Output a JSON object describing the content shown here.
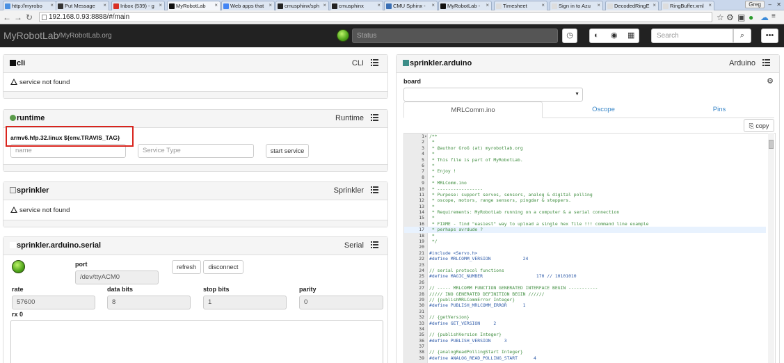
{
  "browser": {
    "tabs": [
      {
        "label": "http://myrobo",
        "color": "#4a90e2"
      },
      {
        "label": "Put Message",
        "color": "#333333"
      },
      {
        "label": "Inbox (539) - g",
        "color": "#d93025"
      },
      {
        "label": "MyRobotLab",
        "color": "#111111"
      },
      {
        "label": "Web apps that",
        "color": "#4285f4"
      },
      {
        "label": "cmusphinx/sph",
        "color": "#222222"
      },
      {
        "label": "cmusphinx",
        "color": "#222222"
      },
      {
        "label": "CMU Sphinx -",
        "color": "#3a6fb5"
      },
      {
        "label": "MyRobotLab -",
        "color": "#111111"
      },
      {
        "label": "Timesheet",
        "color": "#dddddd"
      },
      {
        "label": "Sign in to Azu",
        "color": "#dddddd"
      },
      {
        "label": "DecodedRingE",
        "color": "#dddddd"
      },
      {
        "label": "RingBuffer.xml",
        "color": "#dddddd"
      }
    ],
    "user": "Greg",
    "url": "192.168.0.93:8888/#/main"
  },
  "navbar": {
    "brand": "MyRobotLab",
    "link": "/MyRobotLab.org",
    "status_placeholder": "Status",
    "search_placeholder": "Search"
  },
  "cli": {
    "title": "cli",
    "type": "CLI",
    "message": "service not found"
  },
  "runtime": {
    "title": "runtime",
    "type": "Runtime",
    "version": "armv6.hfp.32.linux ${env.TRAVIS_TAG}",
    "name_placeholder": "name",
    "service_type_placeholder": "Service Type",
    "start_label": "start service"
  },
  "sprinkler": {
    "title": "sprinkler",
    "type": "Sprinkler",
    "message": "service not found"
  },
  "serial": {
    "title": "sprinkler.arduino.serial",
    "type": "Serial",
    "port_label": "port",
    "port_value": "/dev/ttyACM0",
    "refresh_label": "refresh",
    "disconnect_label": "disconnect",
    "rate_label": "rate",
    "rate_value": "57600",
    "databits_label": "data bits",
    "databits_value": "8",
    "stopbits_label": "stop bits",
    "stopbits_value": "1",
    "parity_label": "parity",
    "parity_value": "0",
    "rx_label": "rx 0"
  },
  "arduino": {
    "title": "sprinkler.arduino",
    "type": "Arduino",
    "board_label": "board",
    "tabs": [
      "MRLComm.ino",
      "Oscope",
      "Pins"
    ],
    "copy_label": "copy"
  },
  "code": [
    {
      "n": "1",
      "t": "/**",
      "k": "cm",
      "fold": true
    },
    {
      "n": "2",
      "t": " *",
      "k": "cm"
    },
    {
      "n": "3",
      "t": " * @author GroG (at) myrobotlab.org",
      "k": "cm"
    },
    {
      "n": "4",
      "t": " *",
      "k": "cm"
    },
    {
      "n": "5",
      "t": " * This file is part of MyRobotLab.",
      "k": "cm"
    },
    {
      "n": "6",
      "t": " *",
      "k": "cm"
    },
    {
      "n": "7",
      "t": " * Enjoy !",
      "k": "cm"
    },
    {
      "n": "8",
      "t": " *",
      "k": "cm"
    },
    {
      "n": "9",
      "t": " * MRLComm.ino",
      "k": "cm"
    },
    {
      "n": "10",
      "t": " * -----------------",
      "k": "cm"
    },
    {
      "n": "11",
      "t": " * Purpose: support servos, sensors, analog & digital polling",
      "k": "cm"
    },
    {
      "n": "12",
      "t": " * oscope, motors, range sensors, pingdar & steppers.",
      "k": "cm"
    },
    {
      "n": "13",
      "t": " *",
      "k": "cm"
    },
    {
      "n": "14",
      "t": " * Requirements: MyRobotLab running on a computer & a serial connection",
      "k": "cm"
    },
    {
      "n": "15",
      "t": " *",
      "k": "cm"
    },
    {
      "n": "16",
      "t": " * FIXME - find \"easiest\" way to upload a single hex file !!! command line example",
      "k": "cm"
    },
    {
      "n": "17",
      "t": " * perhaps avrdude ?",
      "k": "cm",
      "hl": true
    },
    {
      "n": "18",
      "t": " *",
      "k": "cm"
    },
    {
      "n": "19",
      "t": " */",
      "k": "cm"
    },
    {
      "n": "20",
      "t": "",
      "k": "pl"
    },
    {
      "n": "21",
      "t": "#include <Servo.h>",
      "k": "pp"
    },
    {
      "n": "22",
      "t": "#define MRLCOMM_VERSION            24",
      "k": "pp"
    },
    {
      "n": "23",
      "t": "",
      "k": "pl"
    },
    {
      "n": "24",
      "t": "// serial protocol functions",
      "k": "cm"
    },
    {
      "n": "25",
      "t": "#define MAGIC_NUMBER                    170 // 10101010",
      "k": "pp"
    },
    {
      "n": "26",
      "t": "",
      "k": "pl"
    },
    {
      "n": "27",
      "t": "// ----- MRLCOMM FUNCTION GENERATED INTERFACE BEGIN -----------",
      "k": "cm"
    },
    {
      "n": "28",
      "t": "///// INO GENERATED DEFINITION BEGIN //////",
      "k": "cm"
    },
    {
      "n": "29",
      "t": "// {publishMRLCommError Integer}",
      "k": "cm"
    },
    {
      "n": "30",
      "t": "#define PUBLISH_MRLCOMM_ERROR      1",
      "k": "pp"
    },
    {
      "n": "31",
      "t": "",
      "k": "pl"
    },
    {
      "n": "32",
      "t": "// {getVersion}",
      "k": "cm"
    },
    {
      "n": "33",
      "t": "#define GET_VERSION     2",
      "k": "pp"
    },
    {
      "n": "34",
      "t": "",
      "k": "pl"
    },
    {
      "n": "35",
      "t": "// {publishVersion Integer}",
      "k": "cm"
    },
    {
      "n": "36",
      "t": "#define PUBLISH_VERSION     3",
      "k": "pp"
    },
    {
      "n": "37",
      "t": "",
      "k": "pl"
    },
    {
      "n": "38",
      "t": "// {analogReadPollingStart Integer}",
      "k": "cm"
    },
    {
      "n": "39",
      "t": "#define ANALOG_READ_POLLING_START      4",
      "k": "pp"
    }
  ]
}
